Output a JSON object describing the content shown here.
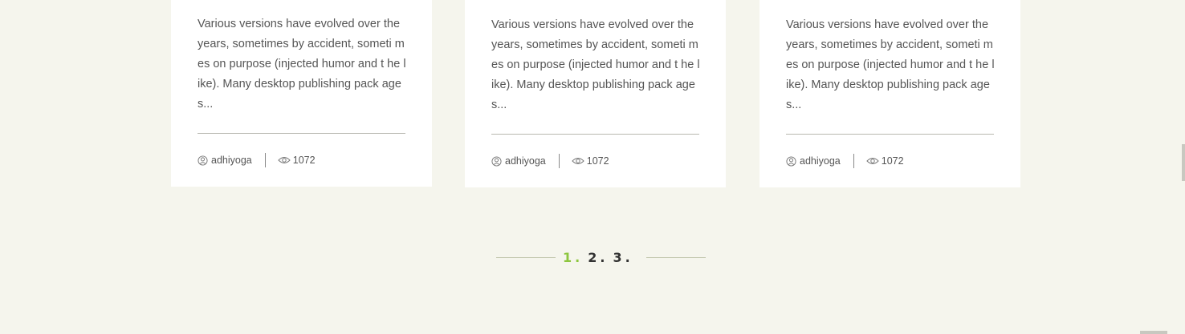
{
  "cards": [
    {
      "excerpt": "Various versions have evolved over the years, sometimes by accident, someti mes on purpose (injected humor and t he like). Many desktop publishing pack ages...",
      "author": "adhiyoga",
      "views": "1072",
      "author_icon": "user-icon",
      "views_icon": "eye-icon"
    },
    {
      "excerpt": "Various versions have evolved over the years, sometimes by accident, someti mes on purpose (injected humor and t he like). Many desktop publishing pack ages...",
      "author": "adhiyoga",
      "views": "1072",
      "author_icon": "user-icon",
      "views_icon": "eye-icon"
    },
    {
      "excerpt": "Various versions have evolved over the years, sometimes by accident, someti mes on purpose (injected humor and t he like). Many desktop publishing pack ages...",
      "author": "adhiyoga",
      "views": "1072",
      "author_icon": "user-icon",
      "views_icon": "eye-icon"
    }
  ],
  "pagination": {
    "pages": [
      "1.",
      "2.",
      "3."
    ],
    "active_index": 0,
    "active_color": "#8dc63f"
  },
  "colors": {
    "background": "#f5f5ed",
    "card": "#ffffff",
    "text": "#555555"
  }
}
